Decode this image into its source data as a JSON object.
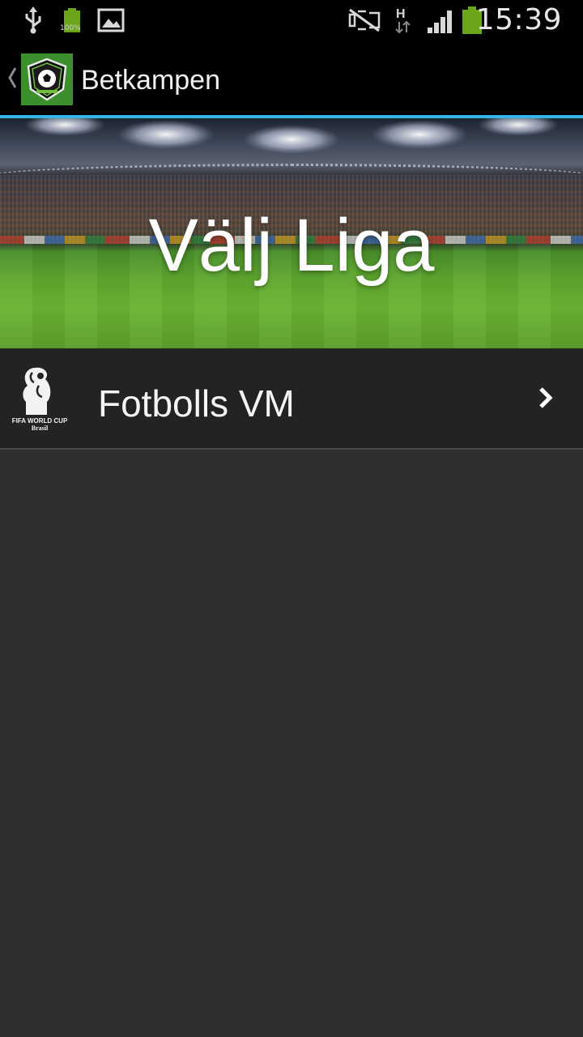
{
  "status_bar": {
    "battery_small_label": "100%",
    "time": "15:39",
    "network_type": "H",
    "icons": [
      "usb-icon",
      "battery-full-icon",
      "gallery-icon",
      "mute-icon",
      "network-h-icon",
      "signal-icon",
      "battery-icon"
    ]
  },
  "action_bar": {
    "title": "Betkampen",
    "accent_color": "#33b5e5",
    "logo_color": "#3c8f2c"
  },
  "hero": {
    "title": "Välj Liga"
  },
  "leagues": [
    {
      "label": "Fotbolls VM",
      "logo_text": "FIFA WORLD CUP",
      "logo_subtext": "Brasil",
      "icon": "world-cup-logo-icon"
    }
  ]
}
